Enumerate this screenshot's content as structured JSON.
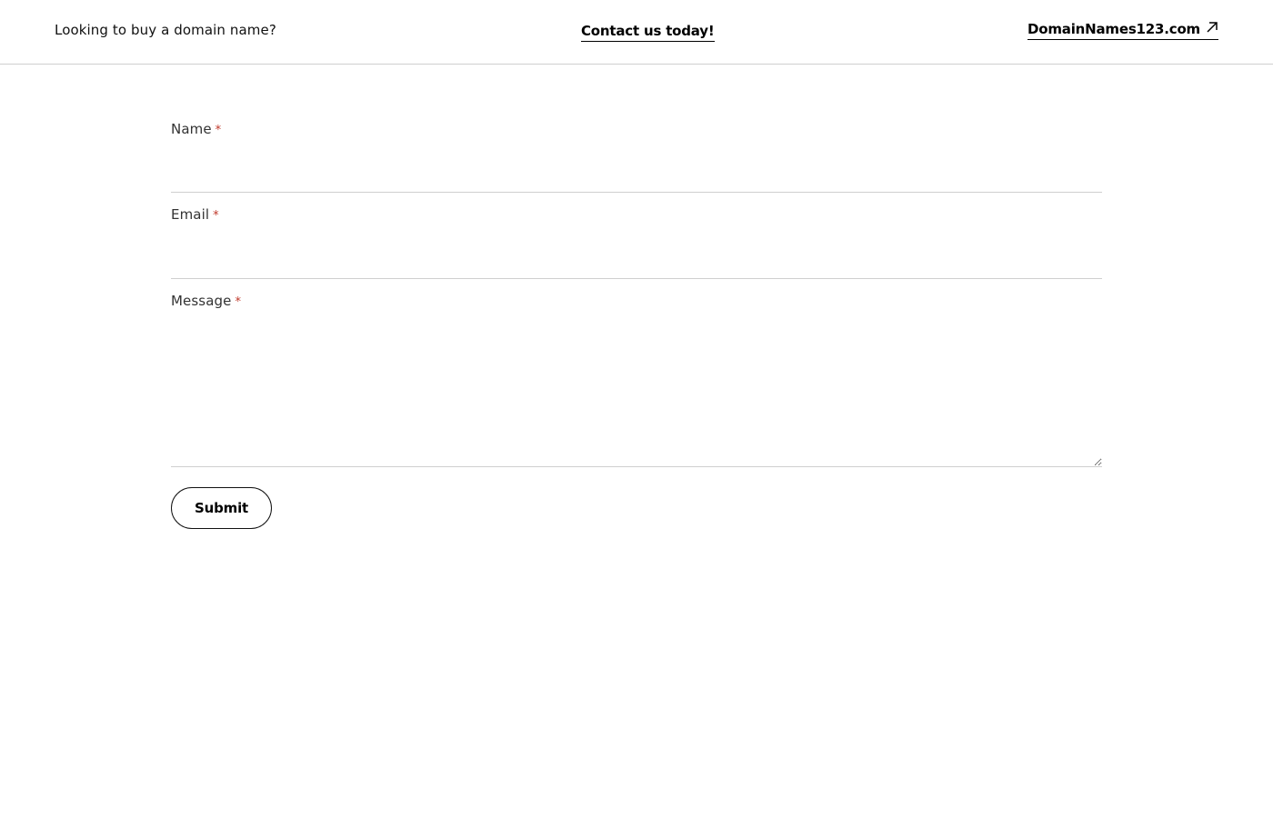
{
  "header": {
    "tagline": "Looking to buy a domain name?",
    "contact_link": "Contact us today!",
    "site_link": "DomainNames123.com",
    "site_link_icon": "external-link-arrow-icon"
  },
  "form": {
    "name": {
      "label": "Name",
      "required_mark": "*",
      "value": ""
    },
    "email": {
      "label": "Email",
      "required_mark": "*",
      "value": ""
    },
    "message": {
      "label": "Message",
      "required_mark": "*",
      "value": ""
    },
    "submit_label": "Submit"
  },
  "colors": {
    "required": "#c0392b",
    "divider": "#cfcfcf",
    "text": "#111111"
  }
}
